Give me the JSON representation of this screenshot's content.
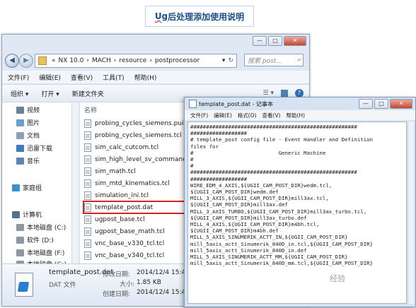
{
  "banner": {
    "ug": "Ug",
    "rest": " 后处理添加使用说明"
  },
  "explorer": {
    "breadcrumb": [
      "«",
      "NX 10.0",
      "›",
      "MACH",
      "›",
      "resource",
      "›",
      "postprocessor"
    ],
    "search_placeholder": "搜索 post...",
    "menu": [
      "文件(F)",
      "编辑(E)",
      "查看(V)",
      "工具(T)",
      "帮助(H)"
    ],
    "toolbar": [
      "组织 ▾",
      "打开 ▾",
      "新建文件夹"
    ],
    "tree": [
      {
        "label": "视频",
        "color": "#6a7f9a"
      },
      {
        "label": "图片",
        "color": "#6d9ed0"
      },
      {
        "label": "文档",
        "color": "#8aa0bb"
      },
      {
        "label": "迅雷下载",
        "color": "#3e7ac2"
      },
      {
        "label": "音乐",
        "color": "#5a84b8"
      },
      {
        "label": "家庭组",
        "color": "#3a8fcf"
      },
      {
        "label": "计算机",
        "color": "#56708e"
      },
      {
        "label": "本地磁盘 (C:)",
        "color": "#8d98a6"
      },
      {
        "label": "软件 (D:)",
        "color": "#8d98a6"
      },
      {
        "label": "本地磁盘 (F:)",
        "color": "#8d98a6"
      },
      {
        "label": "本地磁盘 (G:)",
        "color": "#8d98a6"
      }
    ],
    "column_header": "名称",
    "files": [
      "probing_cycles_siemens.pui",
      "probing_cycles_siemens.tcl",
      "sim_calc_cutcom.tcl",
      "sim_high_level_sv_commands.tcl",
      "sim_math.tcl",
      "sim_mtd_kinematics.tcl",
      "simulation_ini.tcl",
      "template_post.dat",
      "ugpost_base.tcl",
      "ugpost_base_math.tcl",
      "vnc_base_v330_tcl.tcl",
      "vnc_base_v340_tcl.tcl"
    ],
    "selected_file": "template_post.dat",
    "details": {
      "name": "template_post.dat",
      "type": "DAT 文件",
      "modified_label": "修改日期:",
      "modified": "2014/12/4 15:41",
      "size_label": "大小:",
      "size": "1.85 KB",
      "created_label": "创建日期:",
      "created": "2014/12/4 15:41"
    }
  },
  "notepad": {
    "title": "template_post.dat - 记事本",
    "menu": [
      "文件(F)",
      "编辑(E)",
      "格式(O)",
      "查看(V)",
      "帮助(H)"
    ],
    "lines": [
      "#####################################################",
      "##################",
      "# template_post config file - Event Handler and Definition",
      "files for",
      "#                           Generic Machine",
      "#",
      "#",
      "#####################################################",
      "##################",
      "WIRE_EDM_4_AXIS,${UGII_CAM_POST_DIR}wedm.tcl,",
      "${UGII_CAM_POST_DIR}wedm.def",
      "MILL_3_AXIS,${UGII_CAM_POST_DIR}mill3ax.tcl,",
      "${UGII_CAM_POST_DIR}mill3ax.def",
      "MILL_3_AXIS_TURBO,${UGII_CAM_POST_DIR}mill3ax_turbo.tcl,",
      "${UGII_CAM_POST_DIR}mill3ax_turbo.def",
      "MILL_4_AXIS,${UGII_CAM_POST_DIR}m4bh.tcl,",
      "${UGII_CAM_POST_DIR}m4bh.def",
      "MILL_5_AXIS_SINUMERIK_ACTT_IN,${UGII_CAM_POST_DIR}",
      "mill_5axis_actt_Sinumerik_840D_in.tcl,${UGII_CAM_POST_DIR}",
      "mill_5axis_actt_Sinumerik_840D_in.def",
      "MILL_5_AXIS_SINUMERIK_ACTT_MM,${UGII_CAM_POST_DIR}",
      "mill_5axis_actt_Sinumerik_840D_mm.tcl,${UGII_CAM_POST_DIR}"
    ]
  },
  "watermark": "经验"
}
